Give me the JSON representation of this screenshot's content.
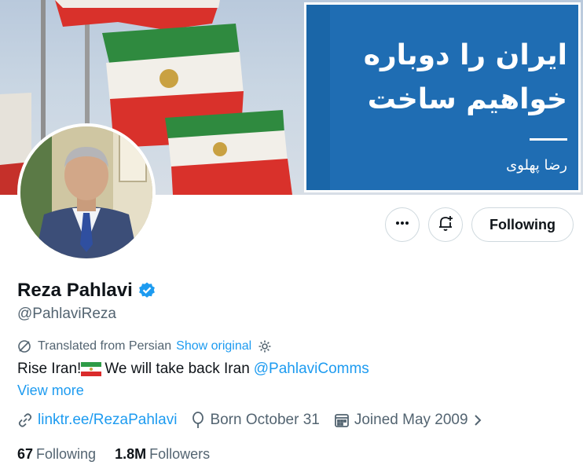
{
  "banner": {
    "headline_line1": "ایران را دوباره",
    "headline_line2": "خواهیم ساخت",
    "signature": "رضا پهلوی",
    "panel_color": "#1f6db3"
  },
  "actions": {
    "more_icon": "more-horizontal-icon",
    "notify_icon": "bell-plus-icon",
    "following_label": "Following"
  },
  "profile": {
    "name": "Reza Pahlavi",
    "verified_icon": "verified-badge-icon",
    "handle": "@PahlaviReza",
    "translated_label": "Translated from Persian",
    "show_original": "Show original",
    "bio_text_before": "Rise Iran!",
    "bio_text_after": "We will take back Iran",
    "bio_mention": "@PahlaviComms",
    "view_more": "View more",
    "website": "linktr.ee/RezaPahlavi",
    "birthday": "Born October 31",
    "joined": "Joined May 2009"
  },
  "stats": {
    "following_count": "67",
    "following_label": "Following",
    "followers_count": "1.8M",
    "followers_label": "Followers"
  },
  "colors": {
    "accent": "#1d9bf0",
    "text": "#0f1419",
    "muted": "#536471",
    "border": "#cfd9de"
  }
}
